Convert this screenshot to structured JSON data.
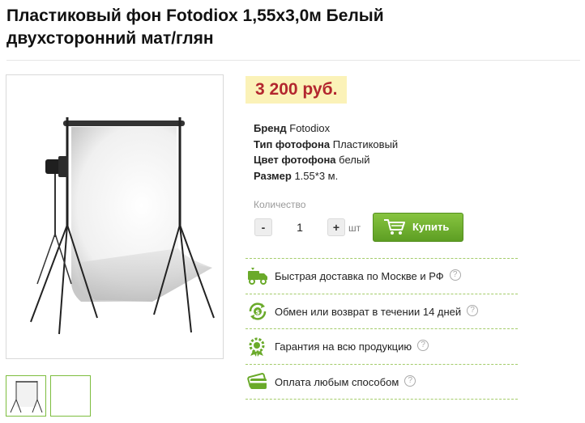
{
  "product": {
    "title_line1": "Пластиковый фон Fotodiox 1,55x3,0м Белый",
    "title_line2": "двухсторонний мат/глян",
    "price": "3 200 руб."
  },
  "specs": [
    {
      "key": "Бренд",
      "value": "Fotodiox"
    },
    {
      "key": "Тип фотофона",
      "value": "Пластиковый"
    },
    {
      "key": "Цвет фотофона",
      "value": "белый"
    },
    {
      "key": "Размер",
      "value": "1.55*3 м."
    }
  ],
  "quantity": {
    "label": "Количество",
    "minus": "-",
    "value": "1",
    "plus": "+",
    "unit": "шт"
  },
  "buy_button": {
    "label": "Купить"
  },
  "features": [
    {
      "text": "Быстрая доставка по Москве и РФ",
      "icon": "delivery-truck-icon"
    },
    {
      "text": "Обмен или возврат в течении 14 дней",
      "icon": "refund-icon"
    },
    {
      "text": "Гарантия на всю продукцию",
      "icon": "warranty-badge-icon"
    },
    {
      "text": "Оплата любым способом",
      "icon": "payment-card-icon"
    }
  ],
  "help_glyph": "?",
  "colors": {
    "accent_green": "#6aaa2a",
    "price_red": "#b3262e",
    "price_bg": "#fbf2b8"
  }
}
